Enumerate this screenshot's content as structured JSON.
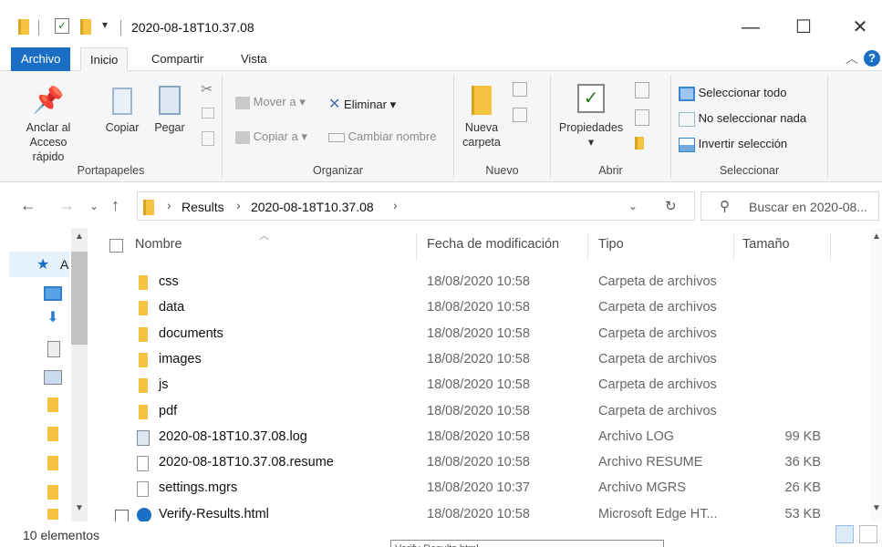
{
  "window": {
    "title": "2020-08-18T10.37.08"
  },
  "tabs": {
    "file": "Archivo",
    "home": "Inicio",
    "share": "Compartir",
    "view": "Vista",
    "help": "?"
  },
  "ribbon": {
    "pin": "Anclar al Acceso rápido",
    "pin_l1": "Anclar al",
    "pin_l2": "Acceso rápido",
    "copy": "Copiar",
    "paste": "Pegar",
    "group_clipboard": "Portapapeles",
    "move_to": "Mover a",
    "copy_to": "Copiar a",
    "delete": "Eliminar",
    "rename": "Cambiar nombre",
    "group_organize": "Organizar",
    "new_folder_l1": "Nueva",
    "new_folder_l2": "carpeta",
    "group_new": "Nuevo",
    "properties": "Propiedades",
    "group_open": "Abrir",
    "select_all": "Seleccionar todo",
    "select_none": "No seleccionar nada",
    "invert_selection": "Invertir selección",
    "group_select": "Seleccionar"
  },
  "address": {
    "crumbs": [
      "Results",
      "2020-08-18T10.37.08"
    ],
    "search_placeholder": "Buscar en 2020-08..."
  },
  "navpane": {
    "quick_access_letter": "A"
  },
  "columns": {
    "name": "Nombre",
    "date": "Fecha de modificación",
    "type": "Tipo",
    "size": "Tamaño"
  },
  "files": [
    {
      "name": "css",
      "date": "18/08/2020 10:58",
      "type": "Carpeta de archivos",
      "size": "",
      "icon": "folder-icon"
    },
    {
      "name": "data",
      "date": "18/08/2020 10:58",
      "type": "Carpeta de archivos",
      "size": "",
      "icon": "folder-icon"
    },
    {
      "name": "documents",
      "date": "18/08/2020 10:58",
      "type": "Carpeta de archivos",
      "size": "",
      "icon": "folder-icon"
    },
    {
      "name": "images",
      "date": "18/08/2020 10:58",
      "type": "Carpeta de archivos",
      "size": "",
      "icon": "folder-icon"
    },
    {
      "name": "js",
      "date": "18/08/2020 10:58",
      "type": "Carpeta de archivos",
      "size": "",
      "icon": "folder-icon"
    },
    {
      "name": "pdf",
      "date": "18/08/2020 10:58",
      "type": "Carpeta de archivos",
      "size": "",
      "icon": "folder-icon"
    },
    {
      "name": "2020-08-18T10.37.08.log",
      "date": "18/08/2020 10:58",
      "type": "Archivo LOG",
      "size": "99 KB",
      "icon": "log-file-icon"
    },
    {
      "name": "2020-08-18T10.37.08.resume",
      "date": "18/08/2020 10:58",
      "type": "Archivo RESUME",
      "size": "36 KB",
      "icon": "file-icon"
    },
    {
      "name": "settings.mgrs",
      "date": "18/08/2020 10:37",
      "type": "Archivo MGRS",
      "size": "26 KB",
      "icon": "file-icon"
    },
    {
      "name": "Verify-Results.html",
      "date": "18/08/2020 10:58",
      "type": "Microsoft Edge HT...",
      "size": "53 KB",
      "icon": "edge-html-icon"
    }
  ],
  "status": {
    "count": "10 elementos",
    "tooltip": "Verify-Results.html"
  },
  "colors": {
    "accent": "#1a6fc4",
    "folder": "#f5c242"
  }
}
